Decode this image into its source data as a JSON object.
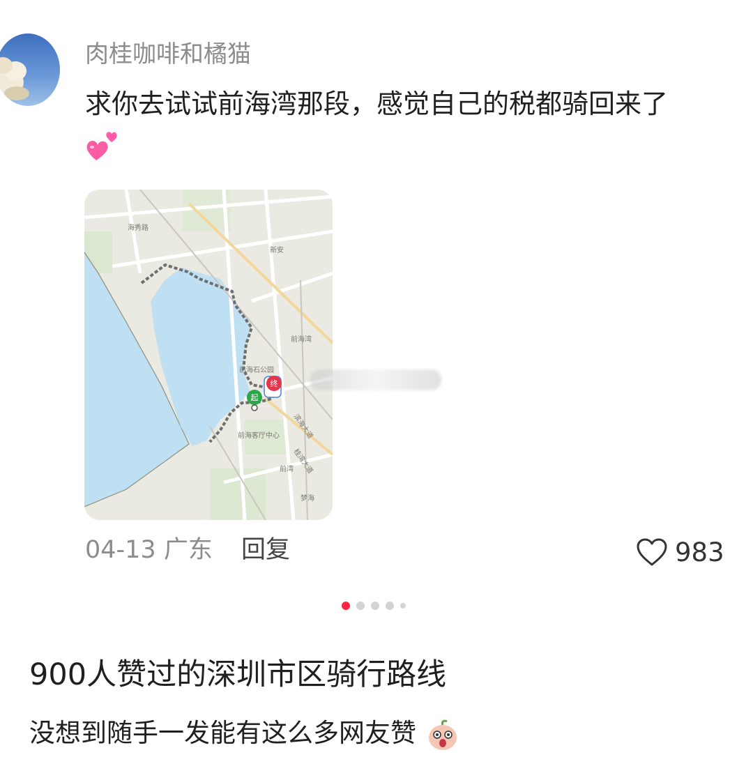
{
  "comment": {
    "username": "肉桂咖啡和橘猫",
    "text": "求你去试试前海湾那段，感觉自己的税都骑回来了",
    "emoji": "two-hearts-emoji",
    "date_location": "04-13 广东",
    "reply_label": "回复",
    "like_count": "983"
  },
  "map": {
    "labels": {
      "haixiu_road": "海秀路",
      "xinan": "新安",
      "qianhaiwan": "前海湾",
      "park": "前海石公园",
      "tourist_center": "前海客厅中心",
      "qianwan": "前湾",
      "mengwan": "梦海",
      "start": "起",
      "end": "终",
      "huanhai": "滨海大道",
      "yuehai": "桂湾大道"
    }
  },
  "carousel": {
    "total": 5,
    "active_index": 0
  },
  "post": {
    "title": "900人赞过的深圳市区骑行路线",
    "description": "没想到随手一发能有这么多网友赞"
  },
  "colors": {
    "accent": "#ff2442",
    "water": "#bfe0f2",
    "route": "#6e6e6e",
    "start_marker": "#2aa84a",
    "end_marker": "#e8344a"
  }
}
